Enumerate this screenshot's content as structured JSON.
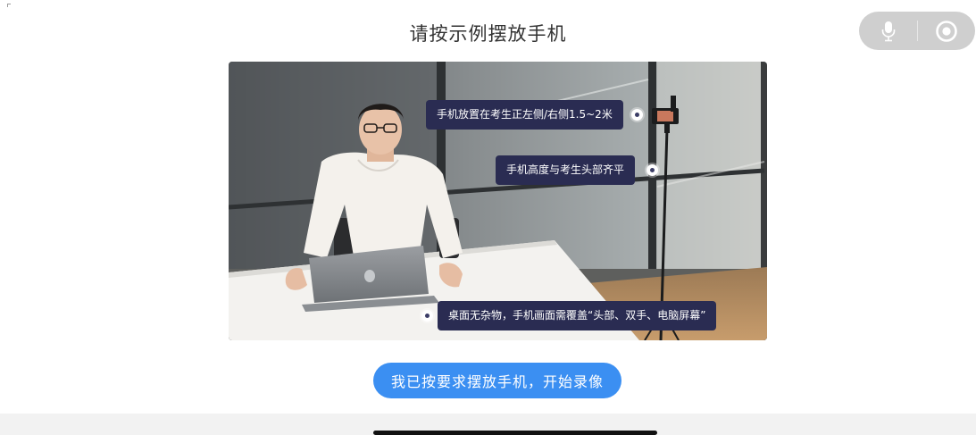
{
  "header": {
    "title": "请按示例摆放手机"
  },
  "controls": {
    "mic_icon": "microphone-icon",
    "record_icon": "record-icon"
  },
  "example": {
    "callouts": [
      {
        "text": "手机放置在考生正左侧/右侧1.5~2米"
      },
      {
        "text": "手机高度与考生头部齐平"
      },
      {
        "text": "桌面无杂物，手机画面需覆盖“头部、双手、电脑屏幕”"
      }
    ]
  },
  "footer": {
    "start_button_label": "我已按要求摆放手机，开始录像"
  },
  "colors": {
    "primary": "#3b8ff2",
    "callout_bg": "#2a2c52",
    "controls_bg": "#cfcfcf"
  }
}
